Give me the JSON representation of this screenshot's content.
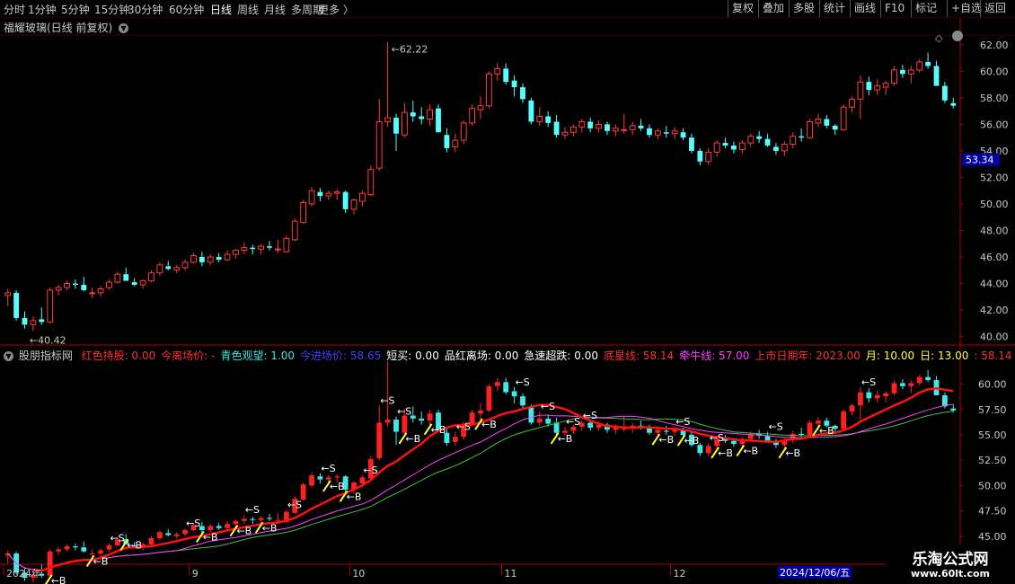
{
  "toolbar": {
    "left": [
      "分时",
      "1分钟",
      "5分钟",
      "15分钟",
      "30分钟",
      "60分钟",
      "日线",
      "周线",
      "月线",
      "多周期",
      "更多 〉"
    ],
    "active": "日线",
    "right": [
      "复权",
      "叠加",
      "多股",
      "统计",
      "画线",
      "F10",
      "标记",
      "+自选",
      "返回"
    ]
  },
  "main": {
    "title": "福耀玻璃(日线 前复权)",
    "price_axis": [
      "62.00",
      "60.00",
      "58.00",
      "56.00",
      "54.00",
      "52.00",
      "50.00",
      "48.00",
      "46.00",
      "44.00",
      "42.00",
      "40.00"
    ],
    "current_price": "53.34",
    "high_label": "62.22",
    "low_label": "40.42"
  },
  "indicator": {
    "name": "股朋指标网",
    "fields": [
      {
        "text": "红色持股: 0.00",
        "color": "#ff3030"
      },
      {
        "text": "今离场价: -",
        "color": "#ff3030"
      },
      {
        "text": "青色观望: 1.00",
        "color": "#40e0e0"
      },
      {
        "text": "今进场价: 58.65",
        "color": "#4040ff"
      },
      {
        "text": "短买: 0.00",
        "color": "#ffffff"
      },
      {
        "text": "品红离场: 0.00",
        "color": "#ffffff"
      },
      {
        "text": "急速超跌: 0.00",
        "color": "#ffffff"
      },
      {
        "text": "底星线: 58.14",
        "color": "#ff3030"
      },
      {
        "text": "牵牛线: 57.00",
        "color": "#ff40ff"
      },
      {
        "text": "上市日期年: 2023.00",
        "color": "#ff3030"
      },
      {
        "text": "月: 10.00",
        "color": "#ffff40"
      },
      {
        "text": "日: 13.00",
        "color": "#ffff40"
      },
      {
        "text": ": 58.14",
        "color": "#ff3030"
      },
      {
        "text": ": 57.0",
        "color": "#ffff40"
      }
    ],
    "axis": [
      "60.00",
      "57.50",
      "55.00",
      "52.50",
      "50.00",
      "47.50",
      "45.00"
    ]
  },
  "date_axis": {
    "labels": [
      "2024年",
      "9",
      "10",
      "11",
      "12"
    ],
    "highlight": "2024/12/06/五"
  },
  "watermark": {
    "line1": "乐淘公式网",
    "line2": "www.60lt.com"
  },
  "colors": {
    "up": "#ff3c3c",
    "down": "#54ffff",
    "grid": "#5a0000",
    "axis": "#b00000"
  },
  "chart_data": {
    "type": "candlestick",
    "title": "福耀玻璃(日线 前复权)",
    "ohlc": [
      [
        43.1,
        43.6,
        42.3,
        43.3
      ],
      [
        43.3,
        43.5,
        41.2,
        41.4
      ],
      [
        41.4,
        41.9,
        40.6,
        40.9
      ],
      [
        40.9,
        41.5,
        40.42,
        41.2
      ],
      [
        41.3,
        42.2,
        40.9,
        41.1
      ],
      [
        41.1,
        43.7,
        41.0,
        43.5
      ],
      [
        43.5,
        43.9,
        43.1,
        43.7
      ],
      [
        43.7,
        44.2,
        43.5,
        44.0
      ],
      [
        44.0,
        44.3,
        43.6,
        43.9
      ],
      [
        43.9,
        44.5,
        43.4,
        43.5
      ],
      [
        43.3,
        43.7,
        42.9,
        43.3
      ],
      [
        43.3,
        43.8,
        43.0,
        43.6
      ],
      [
        43.7,
        44.3,
        43.5,
        44.1
      ],
      [
        44.1,
        44.9,
        44.0,
        44.7
      ],
      [
        44.7,
        45.2,
        44.5,
        44.2
      ],
      [
        44.1,
        44.4,
        43.8,
        43.9
      ],
      [
        43.9,
        44.3,
        43.6,
        44.2
      ],
      [
        44.2,
        45.0,
        44.1,
        44.8
      ],
      [
        44.8,
        45.6,
        44.6,
        45.4
      ],
      [
        45.3,
        45.7,
        45.0,
        45.1
      ],
      [
        45.0,
        45.4,
        44.8,
        45.2
      ],
      [
        45.2,
        45.8,
        45.0,
        45.6
      ],
      [
        45.6,
        46.3,
        45.5,
        46.1
      ],
      [
        46.0,
        46.4,
        45.3,
        45.6
      ],
      [
        45.6,
        46.2,
        45.4,
        46.0
      ],
      [
        46.0,
        46.3,
        45.6,
        45.8
      ],
      [
        45.8,
        46.5,
        45.7,
        46.2
      ],
      [
        46.2,
        46.6,
        45.9,
        46.5
      ],
      [
        46.5,
        47.1,
        46.2,
        46.7
      ],
      [
        46.7,
        46.9,
        46.2,
        46.6
      ],
      [
        46.6,
        47.0,
        46.2,
        46.8
      ],
      [
        46.8,
        47.2,
        46.5,
        46.7
      ],
      [
        46.6,
        47.3,
        46.3,
        46.6
      ],
      [
        46.4,
        47.6,
        46.3,
        47.4
      ],
      [
        47.3,
        48.9,
        47.2,
        48.7
      ],
      [
        48.6,
        50.3,
        48.5,
        50.1
      ],
      [
        50.0,
        51.3,
        49.8,
        51.0
      ],
      [
        50.9,
        51.2,
        50.2,
        50.6
      ],
      [
        50.6,
        51.0,
        50.3,
        50.8
      ],
      [
        50.8,
        51.1,
        50.3,
        50.9
      ],
      [
        50.9,
        51.0,
        49.3,
        49.6
      ],
      [
        49.6,
        50.4,
        49.2,
        50.3
      ],
      [
        50.2,
        51.0,
        49.8,
        50.8
      ],
      [
        50.7,
        52.9,
        50.6,
        52.6
      ],
      [
        52.7,
        57.9,
        52.5,
        56.2
      ],
      [
        56.2,
        62.22,
        55.8,
        56.5
      ],
      [
        56.5,
        56.8,
        54.0,
        55.3
      ],
      [
        55.2,
        57.6,
        55.0,
        56.9
      ],
      [
        56.9,
        57.8,
        56.2,
        56.6
      ],
      [
        56.6,
        57.3,
        56.0,
        56.4
      ],
      [
        56.4,
        57.5,
        55.9,
        57.1
      ],
      [
        57.2,
        57.5,
        55.6,
        55.4
      ],
      [
        55.2,
        55.7,
        53.9,
        54.2
      ],
      [
        54.3,
        55.3,
        53.9,
        54.8
      ],
      [
        54.8,
        56.3,
        54.5,
        56.1
      ],
      [
        56.1,
        57.5,
        55.9,
        57.2
      ],
      [
        57.1,
        58.1,
        56.4,
        57.4
      ],
      [
        57.4,
        60.0,
        57.2,
        59.8
      ],
      [
        59.8,
        60.6,
        59.3,
        60.2
      ],
      [
        60.2,
        60.6,
        59.0,
        59.2
      ],
      [
        59.3,
        59.7,
        58.1,
        58.8
      ],
      [
        58.8,
        59.1,
        57.6,
        57.9
      ],
      [
        57.8,
        58.0,
        56.0,
        56.2
      ],
      [
        56.2,
        57.3,
        55.9,
        56.6
      ],
      [
        56.6,
        57.0,
        55.8,
        56.1
      ],
      [
        56.2,
        56.7,
        55.0,
        55.2
      ],
      [
        55.2,
        55.8,
        54.9,
        55.4
      ],
      [
        55.4,
        56.0,
        55.1,
        55.8
      ],
      [
        55.8,
        56.4,
        55.4,
        56.2
      ],
      [
        56.2,
        56.5,
        55.4,
        55.7
      ],
      [
        55.7,
        56.3,
        55.4,
        56.0
      ],
      [
        56.0,
        56.2,
        55.2,
        55.5
      ],
      [
        55.5,
        56.0,
        55.1,
        55.7
      ],
      [
        55.6,
        56.8,
        55.3,
        55.6
      ],
      [
        55.6,
        56.2,
        55.2,
        55.9
      ],
      [
        55.9,
        56.4,
        55.5,
        55.7
      ],
      [
        55.7,
        56.0,
        55.0,
        55.2
      ],
      [
        55.2,
        55.7,
        54.9,
        55.5
      ],
      [
        55.4,
        55.9,
        55.0,
        55.3
      ],
      [
        55.3,
        55.8,
        54.9,
        55.5
      ],
      [
        55.4,
        55.7,
        54.8,
        55.0
      ],
      [
        55.0,
        55.3,
        53.8,
        54.0
      ],
      [
        54.0,
        54.2,
        52.9,
        53.2
      ],
      [
        53.2,
        54.2,
        52.9,
        53.9
      ],
      [
        53.9,
        54.8,
        53.6,
        54.6
      ],
      [
        54.6,
        55.0,
        54.2,
        54.4
      ],
      [
        54.4,
        54.7,
        53.8,
        54.1
      ],
      [
        54.1,
        54.8,
        53.8,
        54.6
      ],
      [
        54.6,
        55.3,
        54.3,
        55.1
      ],
      [
        55.1,
        55.5,
        54.6,
        54.9
      ],
      [
        54.9,
        55.3,
        54.3,
        54.4
      ],
      [
        54.3,
        54.6,
        53.7,
        54.0
      ],
      [
        54.0,
        54.7,
        53.6,
        54.5
      ],
      [
        54.5,
        55.4,
        54.2,
        55.1
      ],
      [
        55.1,
        55.7,
        54.7,
        55.0
      ],
      [
        55.0,
        56.4,
        54.9,
        56.2
      ],
      [
        56.1,
        56.8,
        55.8,
        56.4
      ],
      [
        56.4,
        56.7,
        55.7,
        55.9
      ],
      [
        55.9,
        56.0,
        55.2,
        55.6
      ],
      [
        55.6,
        57.5,
        55.5,
        57.3
      ],
      [
        57.3,
        58.1,
        56.9,
        57.9
      ],
      [
        57.9,
        59.7,
        56.4,
        59.2
      ],
      [
        59.2,
        59.6,
        58.2,
        58.6
      ],
      [
        58.6,
        59.4,
        58.2,
        58.9
      ],
      [
        58.8,
        59.3,
        58.2,
        59.1
      ],
      [
        59.1,
        60.4,
        58.9,
        60.1
      ],
      [
        60.1,
        60.5,
        59.5,
        59.8
      ],
      [
        59.8,
        60.4,
        59.1,
        60.1
      ],
      [
        60.1,
        60.9,
        59.9,
        60.7
      ],
      [
        60.7,
        61.4,
        60.2,
        60.4
      ],
      [
        60.4,
        60.8,
        59.0,
        58.9
      ],
      [
        58.9,
        59.2,
        57.6,
        57.8
      ],
      [
        57.6,
        58.0,
        57.2,
        57.4
      ]
    ],
    "ylim": [
      39.5,
      62.8
    ],
    "y_ticks": [
      62,
      60,
      58,
      56,
      54,
      52,
      50,
      48,
      46,
      44,
      42,
      40
    ],
    "ind_ylim": [
      42.5,
      62.0
    ],
    "ind_ticks": [
      60,
      57.5,
      55,
      52.5,
      50,
      47.5,
      45
    ],
    "x_labels": [
      {
        "i": 0,
        "t": "2024年"
      },
      {
        "i": 22,
        "t": "9"
      },
      {
        "i": 41,
        "t": "10"
      },
      {
        "i": 59,
        "t": "11"
      },
      {
        "i": 79,
        "t": "12"
      }
    ],
    "signals_S": [
      12,
      21,
      28,
      33,
      37,
      42,
      44,
      46,
      53,
      60,
      63,
      66,
      68,
      79,
      83,
      90,
      101
    ],
    "signals_B": [
      5,
      10,
      14,
      23,
      27,
      30,
      38,
      40,
      47,
      50,
      56,
      65,
      77,
      80,
      84,
      87,
      92,
      96
    ]
  }
}
